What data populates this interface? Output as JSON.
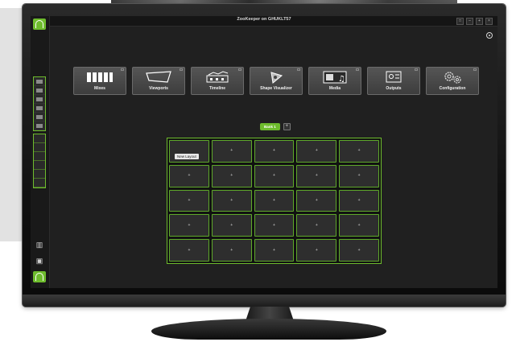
{
  "app": {
    "window_title": "ZooKeeper on GHUKLT57"
  },
  "window_controls": {
    "restore": "□",
    "minimize": "–",
    "maximize": "+",
    "close": "×"
  },
  "toolbar_tiles": [
    {
      "label": "Mixes",
      "icon": "bars-icon"
    },
    {
      "label": "Viewports",
      "icon": "viewport-icon"
    },
    {
      "label": "Timeline",
      "icon": "timeline-icon"
    },
    {
      "label": "Shape Visualizer",
      "icon": "shape-visualizer-icon"
    },
    {
      "label": "Media",
      "icon": "media-icon"
    },
    {
      "label": "Outputs",
      "icon": "outputs-icon"
    },
    {
      "label": "Configuration",
      "icon": "gears-icon"
    }
  ],
  "banks": {
    "active_label": "Bank 1",
    "add_label": "+"
  },
  "layout_grid": {
    "new_layout_tooltip": "New Layout",
    "cell_symbol": "+"
  },
  "colors": {
    "accent": "#6ebc2d",
    "background": "#202020",
    "titlebar": "#151515"
  }
}
